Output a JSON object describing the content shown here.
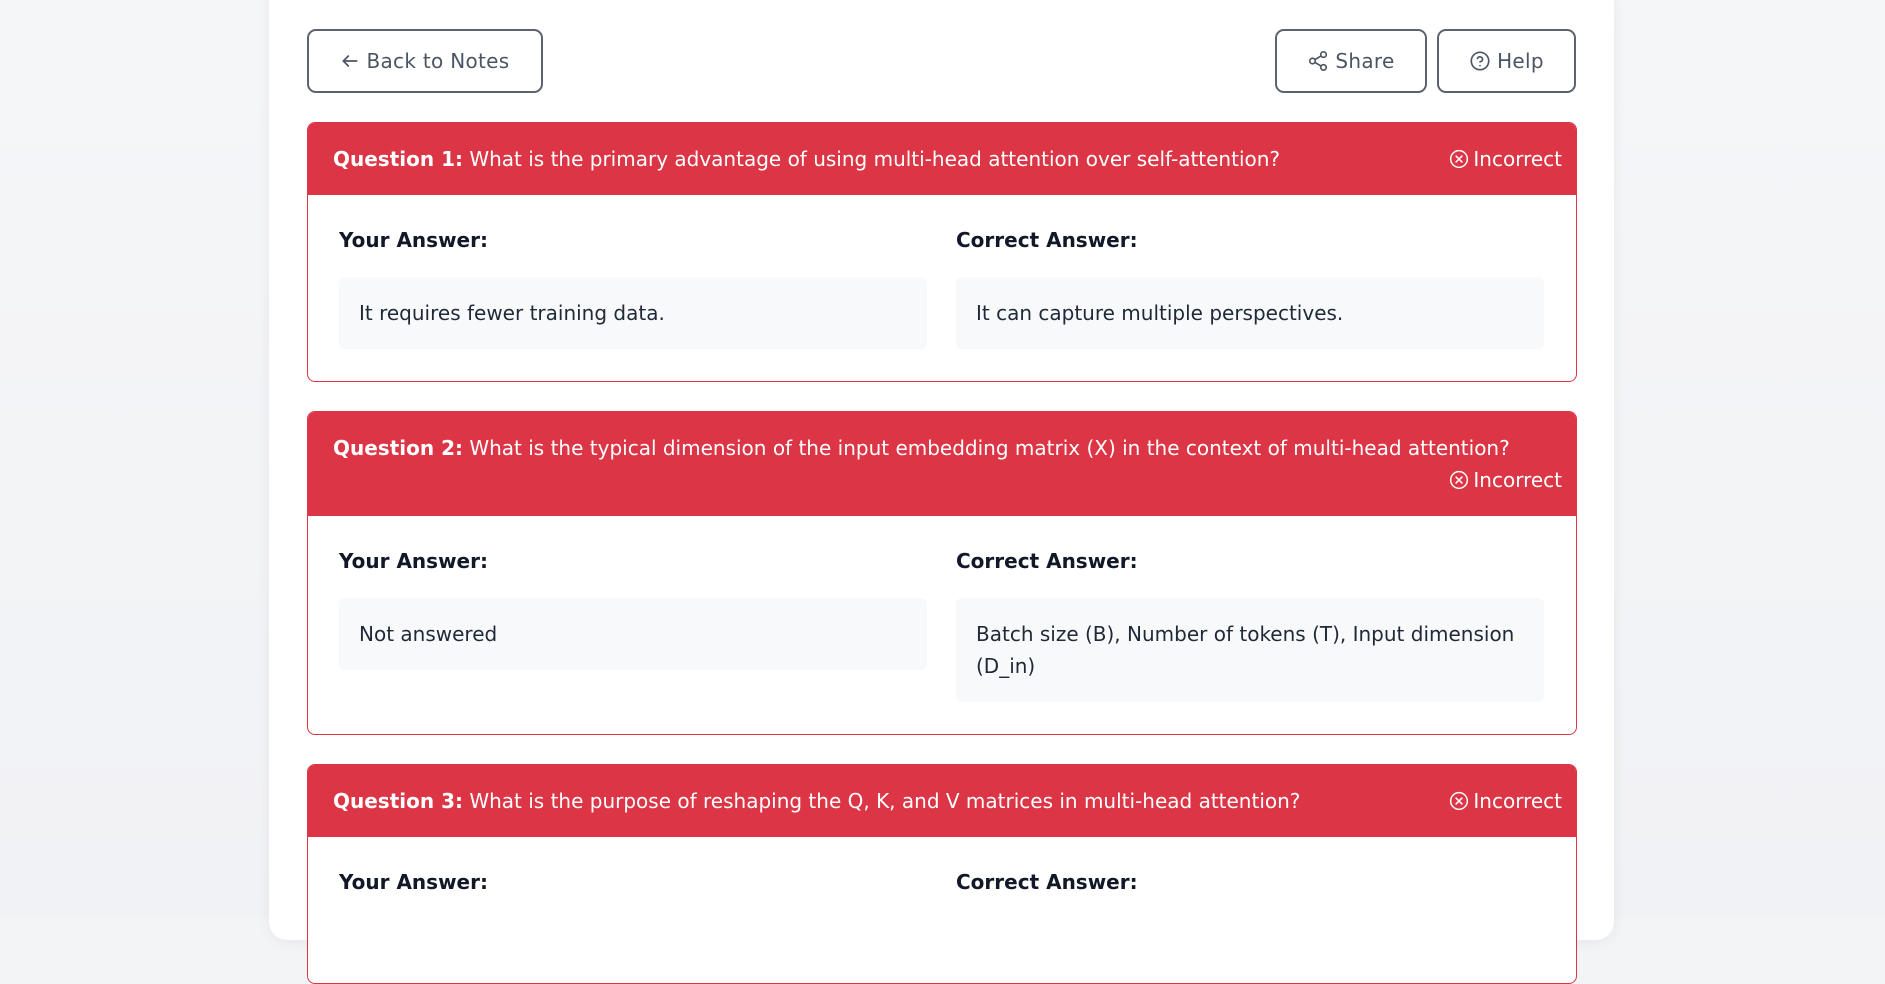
{
  "toolbar": {
    "back_label": "Back to Notes",
    "share_label": "Share",
    "help_label": "Help"
  },
  "questions": [
    {
      "label": "Question 1:",
      "text": "What is the primary advantage of using multi-head attention over self-attention?",
      "status": "Incorrect",
      "your_answer_title": "Your Answer:",
      "your_answer": "It requires fewer training data.",
      "correct_answer_title": "Correct Answer:",
      "correct_answer": "It can capture multiple perspectives."
    },
    {
      "label": "Question 2:",
      "text": "What is the typical dimension of the input embedding matrix (X) in the context of multi-head attention?",
      "status": "Incorrect",
      "your_answer_title": "Your Answer:",
      "your_answer": "Not answered",
      "correct_answer_title": "Correct Answer:",
      "correct_answer": "Batch size (B), Number of tokens (T), Input dimension (D_in)"
    },
    {
      "label": "Question 3:",
      "text": "What is the purpose of reshaping the Q, K, and V matrices in multi-head attention?",
      "status": "Incorrect",
      "your_answer_title": "Your Answer:",
      "correct_answer_title": "Correct Answer:"
    }
  ],
  "colors": {
    "incorrect": "#dc3545",
    "answer_bg": "#f8f9fa",
    "button_border": "#5b6270"
  },
  "icons": {
    "back": "arrow-left-icon",
    "share": "share-icon",
    "help": "help-circle-icon",
    "status": "x-circle-icon"
  }
}
